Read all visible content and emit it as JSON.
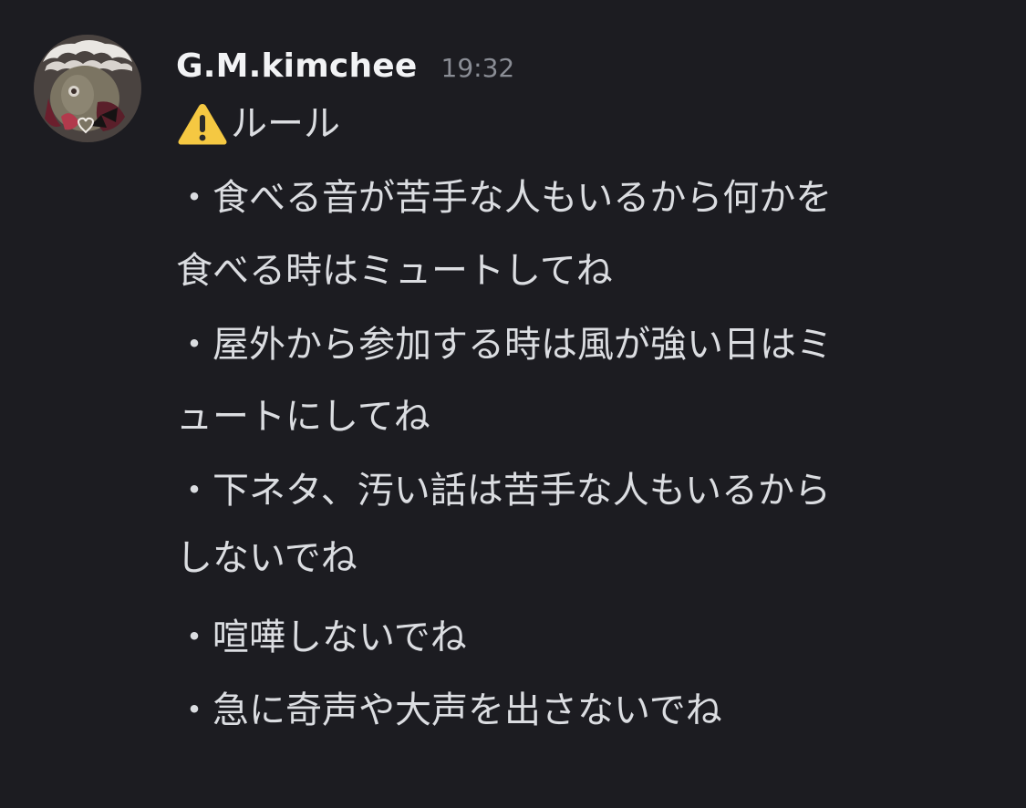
{
  "message": {
    "username": "G.M.kimchee",
    "timestamp": "19:32",
    "avatar_icon": "avatar-image",
    "title_icon": "warning-icon",
    "title": "ルール",
    "lines": [
      "・食べる音が苦手な人もいるから何かを",
      "食べる時はミュートしてね",
      "・屋外から参加する時は風が強い日はミ",
      "ュートにしてね",
      "・下ネタ、汚い話は苦手な人もいるから",
      "しないでね",
      "・喧嘩しないでね",
      "・急に奇声や大声を出さないでね"
    ]
  },
  "colors": {
    "background": "#1c1c21",
    "username": "#f2f3f5",
    "timestamp": "#8a8d95",
    "text": "#dbdde1",
    "warning": "#f5c842"
  }
}
